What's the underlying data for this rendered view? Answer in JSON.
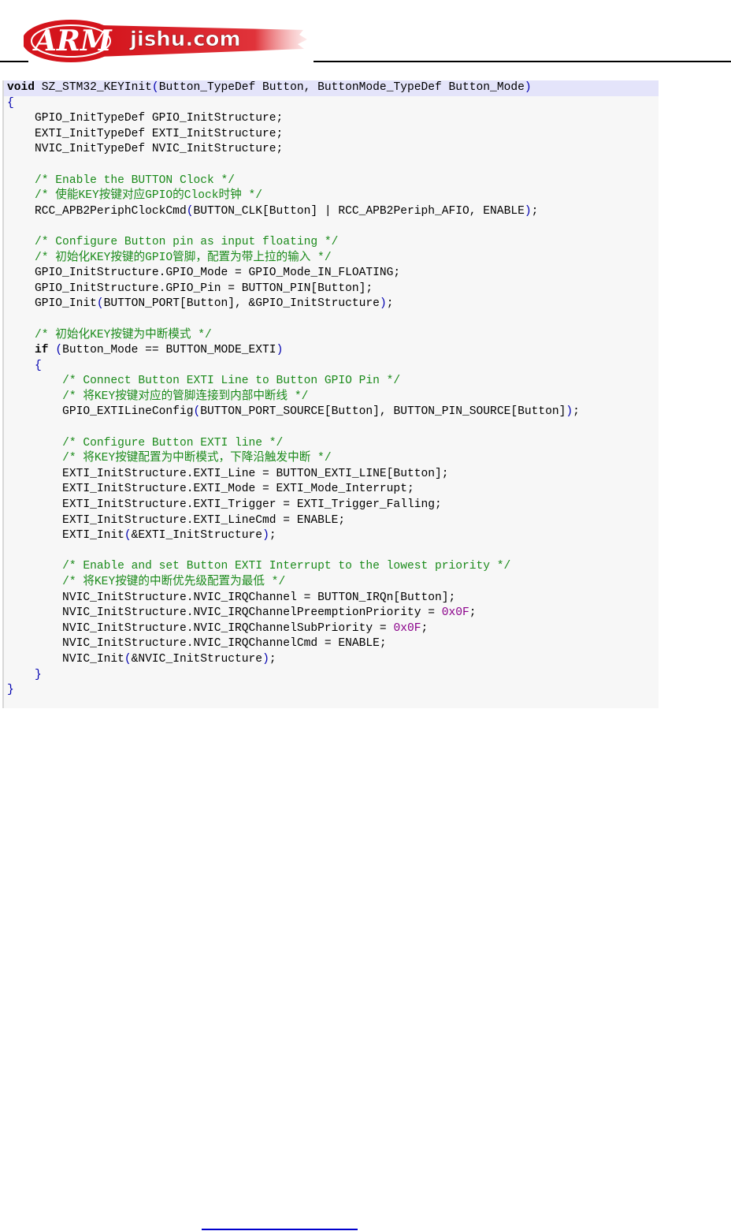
{
  "header": {
    "logo_text": "ARMjishu.com",
    "logo_mark": "ARM",
    "logo_rest": "jishu.com"
  },
  "colors": {
    "keyword": "#000000",
    "comment": "#1a8a1a",
    "number": "#8a008a",
    "logo_red": "#d4141c"
  },
  "code": {
    "lines": [
      "void SZ_STM32_KEYInit(Button_TypeDef Button, ButtonMode_TypeDef Button_Mode)",
      "{",
      "    GPIO_InitTypeDef GPIO_InitStructure;",
      "    EXTI_InitTypeDef EXTI_InitStructure;",
      "    NVIC_InitTypeDef NVIC_InitStructure;",
      "",
      "    /* Enable the BUTTON Clock */",
      "    /* 使能KEY按键对应GPIO的Clock时钟 */",
      "    RCC_APB2PeriphClockCmd(BUTTON_CLK[Button] | RCC_APB2Periph_AFIO, ENABLE);",
      "",
      "    /* Configure Button pin as input floating */",
      "    /* 初始化KEY按键的GPIO管脚，配置为带上拉的输入 */",
      "    GPIO_InitStructure.GPIO_Mode = GPIO_Mode_IN_FLOATING;",
      "    GPIO_InitStructure.GPIO_Pin = BUTTON_PIN[Button];",
      "    GPIO_Init(BUTTON_PORT[Button], &GPIO_InitStructure);",
      "",
      "    /* 初始化KEY按键为中断模式 */",
      "    if (Button_Mode == BUTTON_MODE_EXTI)",
      "    {",
      "        /* Connect Button EXTI Line to Button GPIO Pin */",
      "        /* 将KEY按键对应的管脚连接到内部中断线 */",
      "        GPIO_EXTILineConfig(BUTTON_PORT_SOURCE[Button], BUTTON_PIN_SOURCE[Button]);",
      "",
      "        /* Configure Button EXTI line */",
      "        /* 将KEY按键配置为中断模式，下降沿触发中断 */",
      "        EXTI_InitStructure.EXTI_Line = BUTTON_EXTI_LINE[Button];",
      "        EXTI_InitStructure.EXTI_Mode = EXTI_Mode_Interrupt;",
      "        EXTI_InitStructure.EXTI_Trigger = EXTI_Trigger_Falling;",
      "        EXTI_InitStructure.EXTI_LineCmd = ENABLE;",
      "        EXTI_Init(&EXTI_InitStructure);",
      "",
      "        /* Enable and set Button EXTI Interrupt to the lowest priority */",
      "        /* 将KEY按键的中断优先级配置为最低 */",
      "        NVIC_InitStructure.NVIC_IRQChannel = BUTTON_IRQn[Button];",
      "        NVIC_InitStructure.NVIC_IRQChannelPreemptionPriority = 0x0F;",
      "        NVIC_InitStructure.NVIC_IRQChannelSubPriority = 0x0F;",
      "        NVIC_InitStructure.NVIC_IRQChannelCmd = ENABLE;",
      "        NVIC_Init(&NVIC_InitStructure);",
      "    }",
      "}"
    ]
  }
}
